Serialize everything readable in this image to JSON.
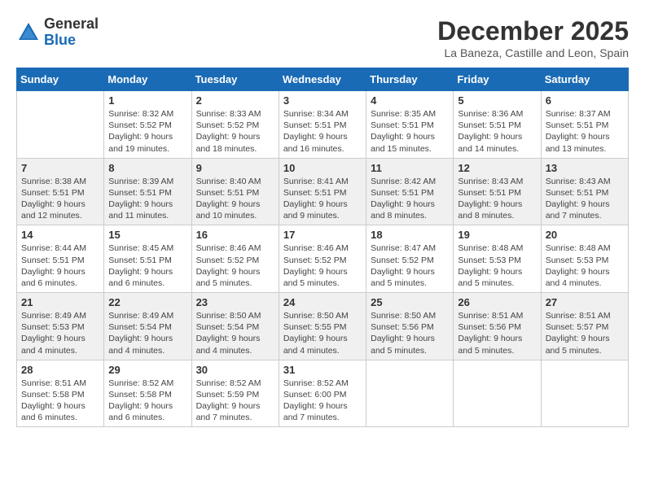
{
  "header": {
    "logo_general": "General",
    "logo_blue": "Blue",
    "month_title": "December 2025",
    "location": "La Baneza, Castille and Leon, Spain"
  },
  "weekdays": [
    "Sunday",
    "Monday",
    "Tuesday",
    "Wednesday",
    "Thursday",
    "Friday",
    "Saturday"
  ],
  "weeks": [
    [
      {
        "day": "",
        "info": ""
      },
      {
        "day": "1",
        "info": "Sunrise: 8:32 AM\nSunset: 5:52 PM\nDaylight: 9 hours\nand 19 minutes."
      },
      {
        "day": "2",
        "info": "Sunrise: 8:33 AM\nSunset: 5:52 PM\nDaylight: 9 hours\nand 18 minutes."
      },
      {
        "day": "3",
        "info": "Sunrise: 8:34 AM\nSunset: 5:51 PM\nDaylight: 9 hours\nand 16 minutes."
      },
      {
        "day": "4",
        "info": "Sunrise: 8:35 AM\nSunset: 5:51 PM\nDaylight: 9 hours\nand 15 minutes."
      },
      {
        "day": "5",
        "info": "Sunrise: 8:36 AM\nSunset: 5:51 PM\nDaylight: 9 hours\nand 14 minutes."
      },
      {
        "day": "6",
        "info": "Sunrise: 8:37 AM\nSunset: 5:51 PM\nDaylight: 9 hours\nand 13 minutes."
      }
    ],
    [
      {
        "day": "7",
        "info": "Sunrise: 8:38 AM\nSunset: 5:51 PM\nDaylight: 9 hours\nand 12 minutes."
      },
      {
        "day": "8",
        "info": "Sunrise: 8:39 AM\nSunset: 5:51 PM\nDaylight: 9 hours\nand 11 minutes."
      },
      {
        "day": "9",
        "info": "Sunrise: 8:40 AM\nSunset: 5:51 PM\nDaylight: 9 hours\nand 10 minutes."
      },
      {
        "day": "10",
        "info": "Sunrise: 8:41 AM\nSunset: 5:51 PM\nDaylight: 9 hours\nand 9 minutes."
      },
      {
        "day": "11",
        "info": "Sunrise: 8:42 AM\nSunset: 5:51 PM\nDaylight: 9 hours\nand 8 minutes."
      },
      {
        "day": "12",
        "info": "Sunrise: 8:43 AM\nSunset: 5:51 PM\nDaylight: 9 hours\nand 8 minutes."
      },
      {
        "day": "13",
        "info": "Sunrise: 8:43 AM\nSunset: 5:51 PM\nDaylight: 9 hours\nand 7 minutes."
      }
    ],
    [
      {
        "day": "14",
        "info": "Sunrise: 8:44 AM\nSunset: 5:51 PM\nDaylight: 9 hours\nand 6 minutes."
      },
      {
        "day": "15",
        "info": "Sunrise: 8:45 AM\nSunset: 5:51 PM\nDaylight: 9 hours\nand 6 minutes."
      },
      {
        "day": "16",
        "info": "Sunrise: 8:46 AM\nSunset: 5:52 PM\nDaylight: 9 hours\nand 5 minutes."
      },
      {
        "day": "17",
        "info": "Sunrise: 8:46 AM\nSunset: 5:52 PM\nDaylight: 9 hours\nand 5 minutes."
      },
      {
        "day": "18",
        "info": "Sunrise: 8:47 AM\nSunset: 5:52 PM\nDaylight: 9 hours\nand 5 minutes."
      },
      {
        "day": "19",
        "info": "Sunrise: 8:48 AM\nSunset: 5:53 PM\nDaylight: 9 hours\nand 5 minutes."
      },
      {
        "day": "20",
        "info": "Sunrise: 8:48 AM\nSunset: 5:53 PM\nDaylight: 9 hours\nand 4 minutes."
      }
    ],
    [
      {
        "day": "21",
        "info": "Sunrise: 8:49 AM\nSunset: 5:53 PM\nDaylight: 9 hours\nand 4 minutes."
      },
      {
        "day": "22",
        "info": "Sunrise: 8:49 AM\nSunset: 5:54 PM\nDaylight: 9 hours\nand 4 minutes."
      },
      {
        "day": "23",
        "info": "Sunrise: 8:50 AM\nSunset: 5:54 PM\nDaylight: 9 hours\nand 4 minutes."
      },
      {
        "day": "24",
        "info": "Sunrise: 8:50 AM\nSunset: 5:55 PM\nDaylight: 9 hours\nand 4 minutes."
      },
      {
        "day": "25",
        "info": "Sunrise: 8:50 AM\nSunset: 5:56 PM\nDaylight: 9 hours\nand 5 minutes."
      },
      {
        "day": "26",
        "info": "Sunrise: 8:51 AM\nSunset: 5:56 PM\nDaylight: 9 hours\nand 5 minutes."
      },
      {
        "day": "27",
        "info": "Sunrise: 8:51 AM\nSunset: 5:57 PM\nDaylight: 9 hours\nand 5 minutes."
      }
    ],
    [
      {
        "day": "28",
        "info": "Sunrise: 8:51 AM\nSunset: 5:58 PM\nDaylight: 9 hours\nand 6 minutes."
      },
      {
        "day": "29",
        "info": "Sunrise: 8:52 AM\nSunset: 5:58 PM\nDaylight: 9 hours\nand 6 minutes."
      },
      {
        "day": "30",
        "info": "Sunrise: 8:52 AM\nSunset: 5:59 PM\nDaylight: 9 hours\nand 7 minutes."
      },
      {
        "day": "31",
        "info": "Sunrise: 8:52 AM\nSunset: 6:00 PM\nDaylight: 9 hours\nand 7 minutes."
      },
      {
        "day": "",
        "info": ""
      },
      {
        "day": "",
        "info": ""
      },
      {
        "day": "",
        "info": ""
      }
    ]
  ]
}
